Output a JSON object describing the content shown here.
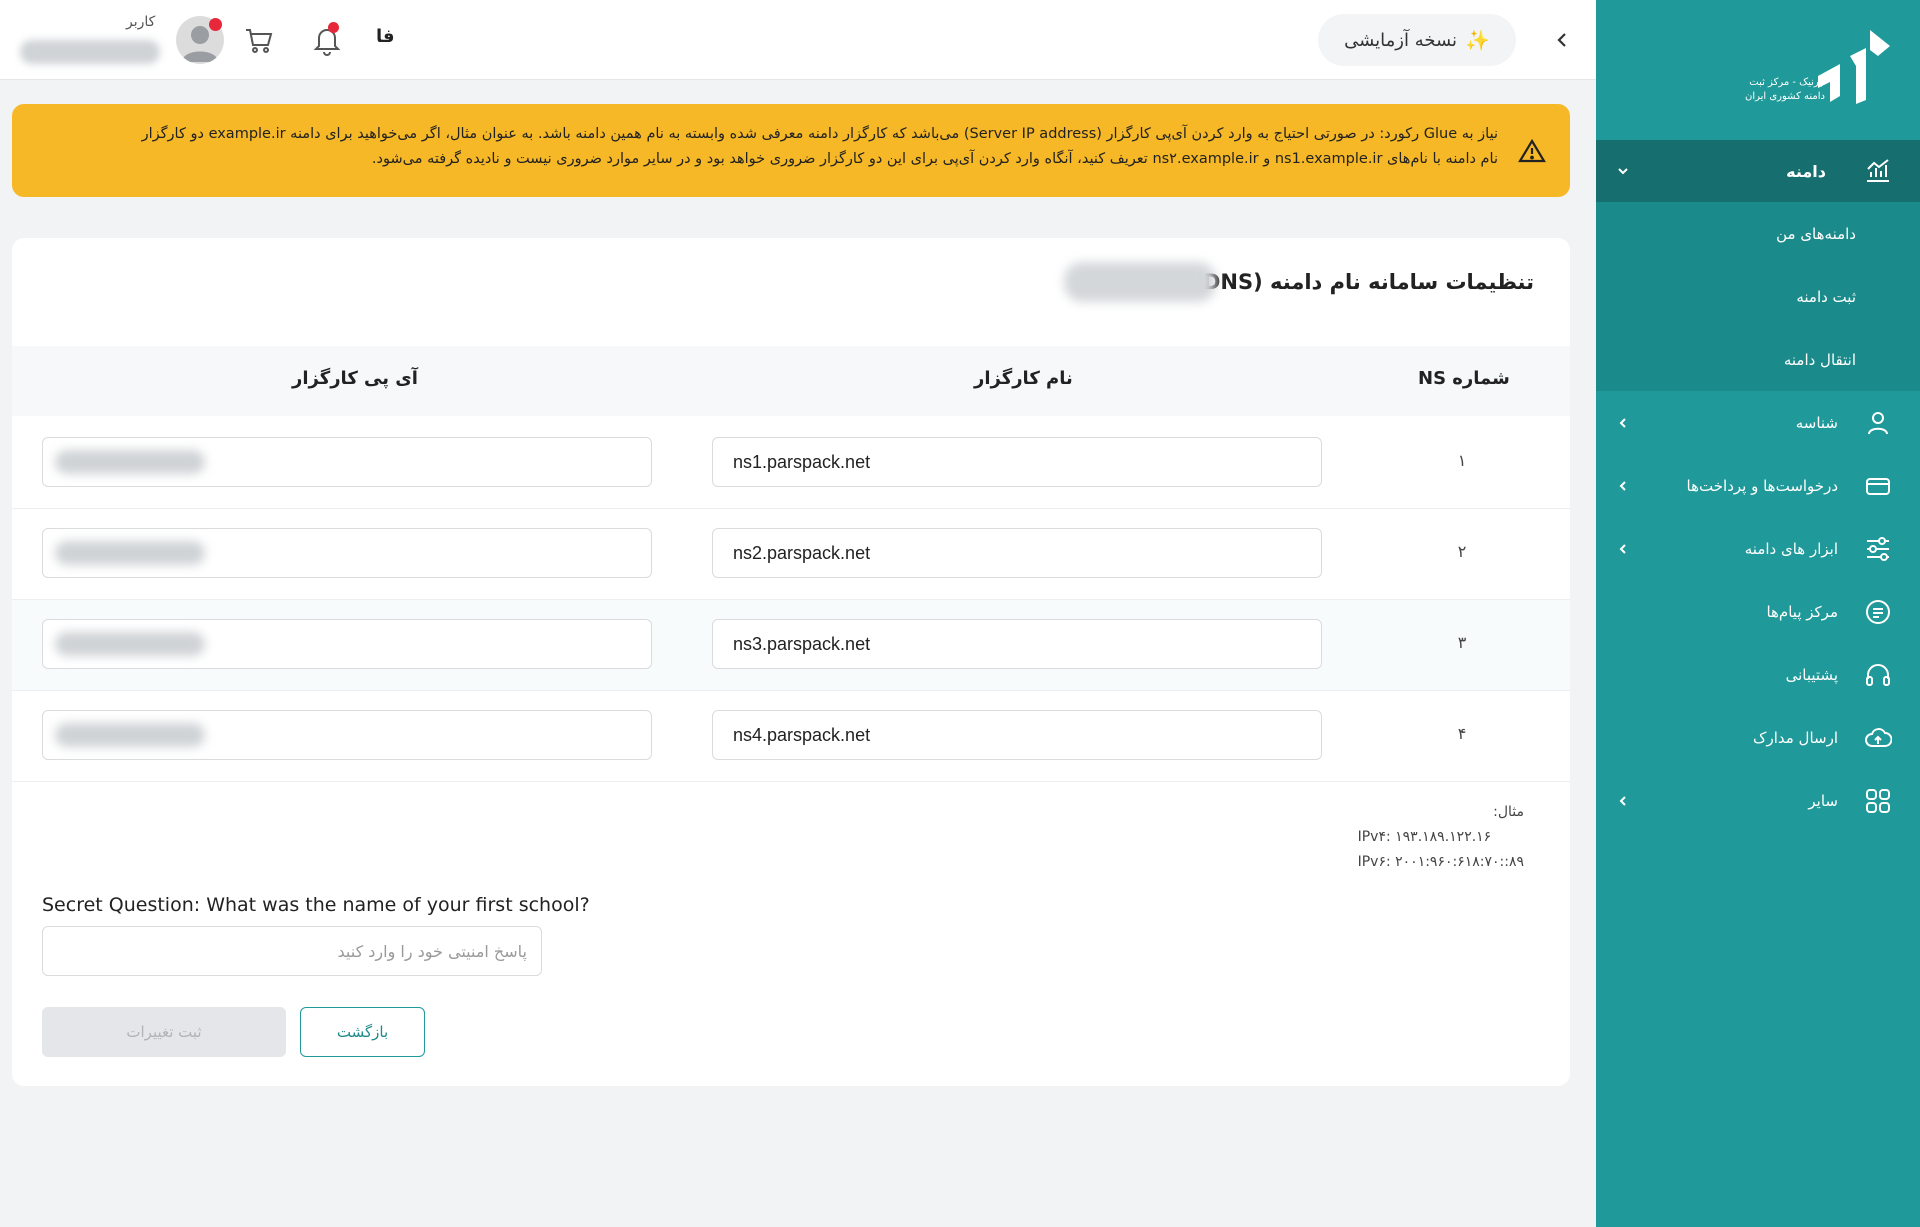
{
  "brand": {
    "logo_text": "ایرنیک - مرکز ثبت\nدامنه کشوری ایران",
    "accent_color": "#1f9999",
    "warning_color": "#f6b826"
  },
  "sidebar": {
    "domain_section": {
      "label": "دامنه",
      "icon": "chart-icon",
      "sub_items": [
        {
          "label": "دامنه‌های من"
        },
        {
          "label": "ثبت دامنه"
        },
        {
          "label": "انتقال دامنه"
        }
      ]
    },
    "items": [
      {
        "label": "شناسه",
        "icon": "user-icon",
        "has_chevron": true
      },
      {
        "label": "درخواست‌ها و پرداخت‌ها",
        "icon": "card-icon",
        "has_chevron": true
      },
      {
        "label": "ابزار های دامنه",
        "icon": "sliders-icon",
        "has_chevron": true
      },
      {
        "label": "مرکز پیام‌ها",
        "icon": "message-icon",
        "has_chevron": false
      },
      {
        "label": "پشتیبانی",
        "icon": "headset-icon",
        "has_chevron": false
      },
      {
        "label": "ارسال مدارک",
        "icon": "cloud-upload-icon",
        "has_chevron": false
      },
      {
        "label": "سایر",
        "icon": "grid-icon",
        "has_chevron": true
      }
    ]
  },
  "topbar": {
    "trial_label": "نسخه آزمایشی",
    "trial_icon": "sparkle-icon",
    "language": "فا",
    "user_role": "کاربر"
  },
  "alert": {
    "line1": "نیاز به Glue رکورد: در صورتی احتیاج به وارد کردن آی‌پی کارگزار (Server IP address) می‌باشد که کارگزار دامنه معرفی شده وابسته به نام همین دامنه باشد. به عنوان مثال، اگر می‌خواهید برای دامنه example.ir دو کارگزار",
    "line2": "نام دامنه با نام‌های ns1.example.ir و ns۲.example.ir تعریف کنید، آنگاه وارد کردن آی‌پی برای این دو کارگزار ضروری خواهد بود و در سایر موارد ضروری نیست و نادیده گرفته می‌شود."
  },
  "card": {
    "title": "تنظیمات سامانه نام دامنه (DNS)",
    "columns": {
      "ns_number": "شماره NS",
      "server_name": "نام کارگزار",
      "server_ip": "آی پی کارگزار"
    },
    "rows": [
      {
        "num": "۱",
        "server": "ns1.parspack.net"
      },
      {
        "num": "۲",
        "server": "ns2.parspack.net"
      },
      {
        "num": "۳",
        "server": "ns3.parspack.net"
      },
      {
        "num": "۴",
        "server": "ns4.parspack.net"
      }
    ],
    "example": {
      "label": "مثال:",
      "ipv4": "IPv۴: ۱۹۳.۱۸۹.۱۲۲.۱۶",
      "ipv6": "IPv۶: ۲۰۰۱:۹۶۰:۶۱۸:۷۰::۸۹"
    },
    "secret_question": "Secret Question: What was the name of your first school?",
    "secret_placeholder": "پاسخ امنیتی خود را وارد کنید",
    "save_button": "ثبت تغییرات",
    "back_button": "بازگشت"
  }
}
